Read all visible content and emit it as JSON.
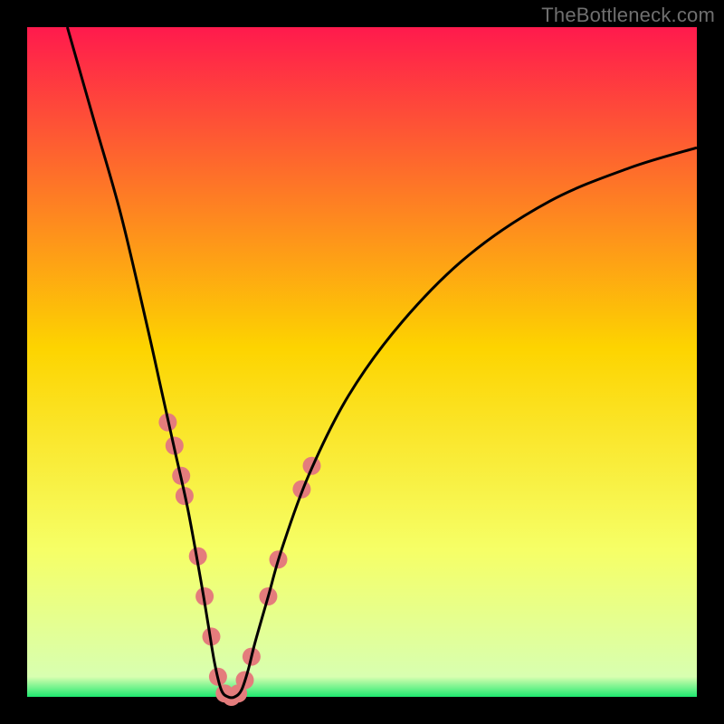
{
  "watermark": "TheBottleneck.com",
  "chart_data": {
    "type": "line",
    "title": "",
    "xlabel": "",
    "ylabel": "",
    "xlim": [
      0,
      100
    ],
    "ylim": [
      0,
      100
    ],
    "background": {
      "gradient_top": "#ff1a4d",
      "gradient_mid": "#fdd400",
      "gradient_lower": "#f6ff66",
      "gradient_bottom": "#1ee86f",
      "frame_color": "#000000"
    },
    "series": [
      {
        "name": "bottleneck-curve",
        "stroke": "#000000",
        "x": [
          6,
          10,
          14,
          18,
          20,
          22,
          24,
          26,
          27,
          28,
          29,
          30,
          31,
          32,
          33,
          34,
          36,
          38,
          42,
          48,
          56,
          66,
          78,
          90,
          100
        ],
        "y": [
          100,
          86,
          72,
          55,
          46,
          37,
          28,
          17,
          11,
          5,
          1,
          0,
          0,
          1,
          4,
          8,
          15,
          22,
          33,
          45,
          56,
          66,
          74,
          79,
          82
        ]
      }
    ],
    "markers": {
      "name": "highlight-dots",
      "fill": "#e47c7c",
      "radius_px": 10,
      "points": [
        {
          "x": 21.0,
          "y": 41.0
        },
        {
          "x": 22.0,
          "y": 37.5
        },
        {
          "x": 23.0,
          "y": 33.0
        },
        {
          "x": 23.5,
          "y": 30.0
        },
        {
          "x": 25.5,
          "y": 21.0
        },
        {
          "x": 26.5,
          "y": 15.0
        },
        {
          "x": 27.5,
          "y": 9.0
        },
        {
          "x": 28.5,
          "y": 3.0
        },
        {
          "x": 29.5,
          "y": 0.5
        },
        {
          "x": 30.5,
          "y": 0.0
        },
        {
          "x": 31.5,
          "y": 0.5
        },
        {
          "x": 32.5,
          "y": 2.5
        },
        {
          "x": 33.5,
          "y": 6.0
        },
        {
          "x": 36.0,
          "y": 15.0
        },
        {
          "x": 37.5,
          "y": 20.5
        },
        {
          "x": 41.0,
          "y": 31.0
        },
        {
          "x": 42.5,
          "y": 34.5
        }
      ]
    }
  }
}
